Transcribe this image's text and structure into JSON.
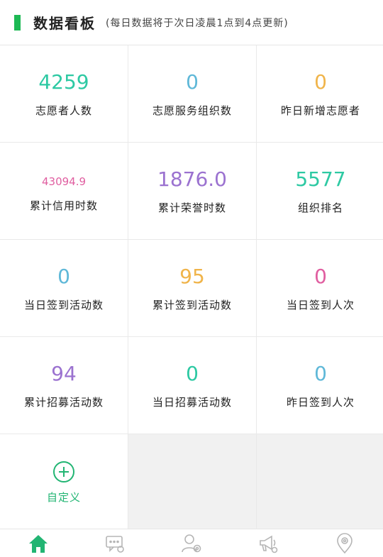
{
  "header": {
    "title": "数据看板",
    "subtitle": "(每日数据将于次日凌晨1点到4点更新)"
  },
  "stats": [
    {
      "value": "4259",
      "label": "志愿者人数",
      "color": "#2dc9a3"
    },
    {
      "value": "0",
      "label": "志愿服务组织数",
      "color": "#5fb8d8"
    },
    {
      "value": "0",
      "label": "昨日新增志愿者",
      "color": "#f0b44a"
    },
    {
      "value": "43094.9",
      "label": "累计信用时数",
      "color": "#e05ea0"
    },
    {
      "value": "1876.0",
      "label": "累计荣誉时数",
      "color": "#9b72d0"
    },
    {
      "value": "5577",
      "label": "组织排名",
      "color": "#2dc9a3"
    },
    {
      "value": "0",
      "label": "当日签到活动数",
      "color": "#5fb8d8"
    },
    {
      "value": "95",
      "label": "累计签到活动数",
      "color": "#f0b44a"
    },
    {
      "value": "0",
      "label": "当日签到人次",
      "color": "#e05ea0"
    },
    {
      "value": "94",
      "label": "累计招募活动数",
      "color": "#9b72d0"
    },
    {
      "value": "0",
      "label": "当日招募活动数",
      "color": "#2dc9a3"
    },
    {
      "value": "0",
      "label": "昨日签到人次",
      "color": "#5fb8d8"
    }
  ],
  "custom": {
    "label": "自定义",
    "icon": "plus-circle-icon"
  },
  "tabbar": {
    "accent": "#22b573",
    "inactive": "#b5b5b5",
    "tabs": [
      {
        "icon": "home-icon",
        "active": true
      },
      {
        "icon": "chat-settings-icon",
        "active": false
      },
      {
        "icon": "user-settings-icon",
        "active": false
      },
      {
        "icon": "megaphone-settings-icon",
        "active": false
      },
      {
        "icon": "location-settings-icon",
        "active": false
      }
    ]
  }
}
